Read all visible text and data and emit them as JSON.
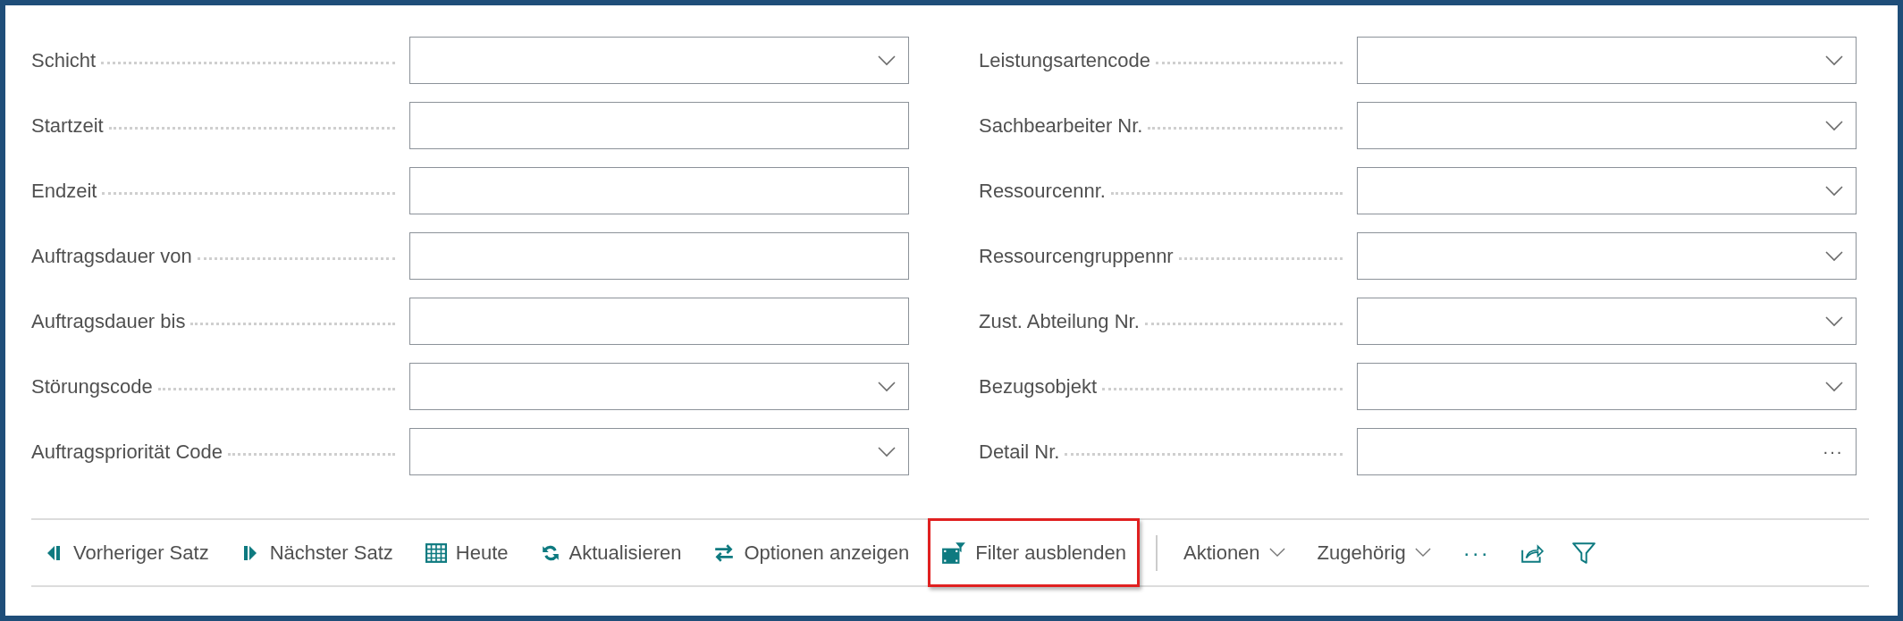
{
  "left_fields": [
    {
      "label": "Schicht",
      "kind": "dropdown"
    },
    {
      "label": "Startzeit",
      "kind": "text"
    },
    {
      "label": "Endzeit",
      "kind": "text"
    },
    {
      "label": "Auftragsdauer von",
      "kind": "text"
    },
    {
      "label": "Auftragsdauer bis",
      "kind": "text"
    },
    {
      "label": "Störungscode",
      "kind": "dropdown"
    },
    {
      "label": "Auftragspriorität Code",
      "kind": "dropdown"
    }
  ],
  "right_fields": [
    {
      "label": "Leistungsartencode",
      "kind": "dropdown"
    },
    {
      "label": "Sachbearbeiter Nr.",
      "kind": "dropdown"
    },
    {
      "label": "Ressourcennr.",
      "kind": "dropdown"
    },
    {
      "label": "Ressourcengruppennr",
      "kind": "dropdown"
    },
    {
      "label": "Zust. Abteilung Nr.",
      "kind": "dropdown"
    },
    {
      "label": "Bezugsobjekt",
      "kind": "dropdown"
    },
    {
      "label": "Detail Nr.",
      "kind": "lookup",
      "button": "···"
    }
  ],
  "toolbar": [
    {
      "label": "Vorheriger Satz",
      "kind": "previous",
      "highlighted": false
    },
    {
      "label": "Nächster Satz",
      "kind": "next",
      "highlighted": false
    },
    {
      "label": "Heute",
      "kind": "calendar",
      "highlighted": false
    },
    {
      "label": "Aktualisieren",
      "kind": "refresh",
      "highlighted": false
    },
    {
      "label": "Optionen anzeigen",
      "kind": "swap",
      "highlighted": false
    },
    {
      "label": "Filter ausblenden",
      "kind": "filter-hide",
      "highlighted": true
    },
    {
      "label": "Aktionen",
      "kind": "menu",
      "highlighted": false
    },
    {
      "label": "Zugehörig",
      "kind": "menu",
      "highlighted": false
    },
    {
      "label": "···",
      "kind": "more",
      "highlighted": false
    },
    {
      "kind": "share",
      "highlighted": false
    },
    {
      "kind": "filter",
      "highlighted": false
    }
  ]
}
